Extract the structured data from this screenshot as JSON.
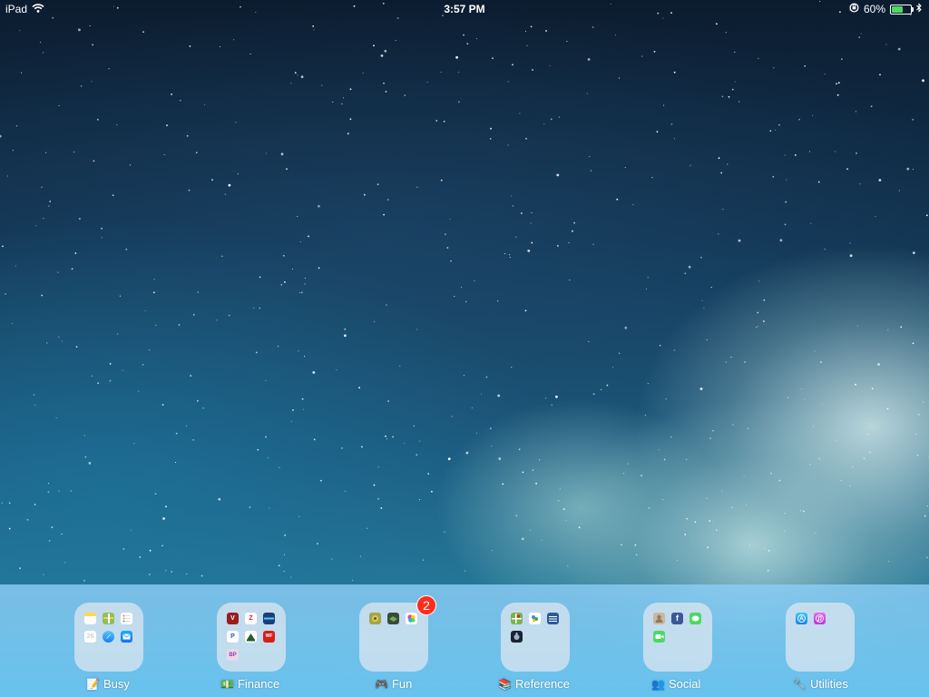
{
  "status_bar": {
    "device": "iPad",
    "time": "3:57 PM",
    "battery_percent": "60%",
    "battery_level": 0.6,
    "wifi_icon": "wifi-icon",
    "rotation_lock_icon": "rotation-lock-icon",
    "bluetooth_icon": "bluetooth-icon"
  },
  "dock": {
    "folders": [
      {
        "name": "Busy",
        "label_icon": "notepad-icon"
      },
      {
        "name": "Finance",
        "label_icon": "banknote-icon"
      },
      {
        "name": "Fun",
        "label_icon": "game-controller-icon",
        "badge": "2"
      },
      {
        "name": "Reference",
        "label_icon": "books-icon"
      },
      {
        "name": "Social",
        "label_icon": "people-icon"
      },
      {
        "name": "Utilities",
        "label_icon": "tools-icon"
      }
    ]
  },
  "colors": {
    "badge": "#ff2d1a",
    "dock": "#7ccbf2",
    "battery_fill": "#4cd964"
  }
}
